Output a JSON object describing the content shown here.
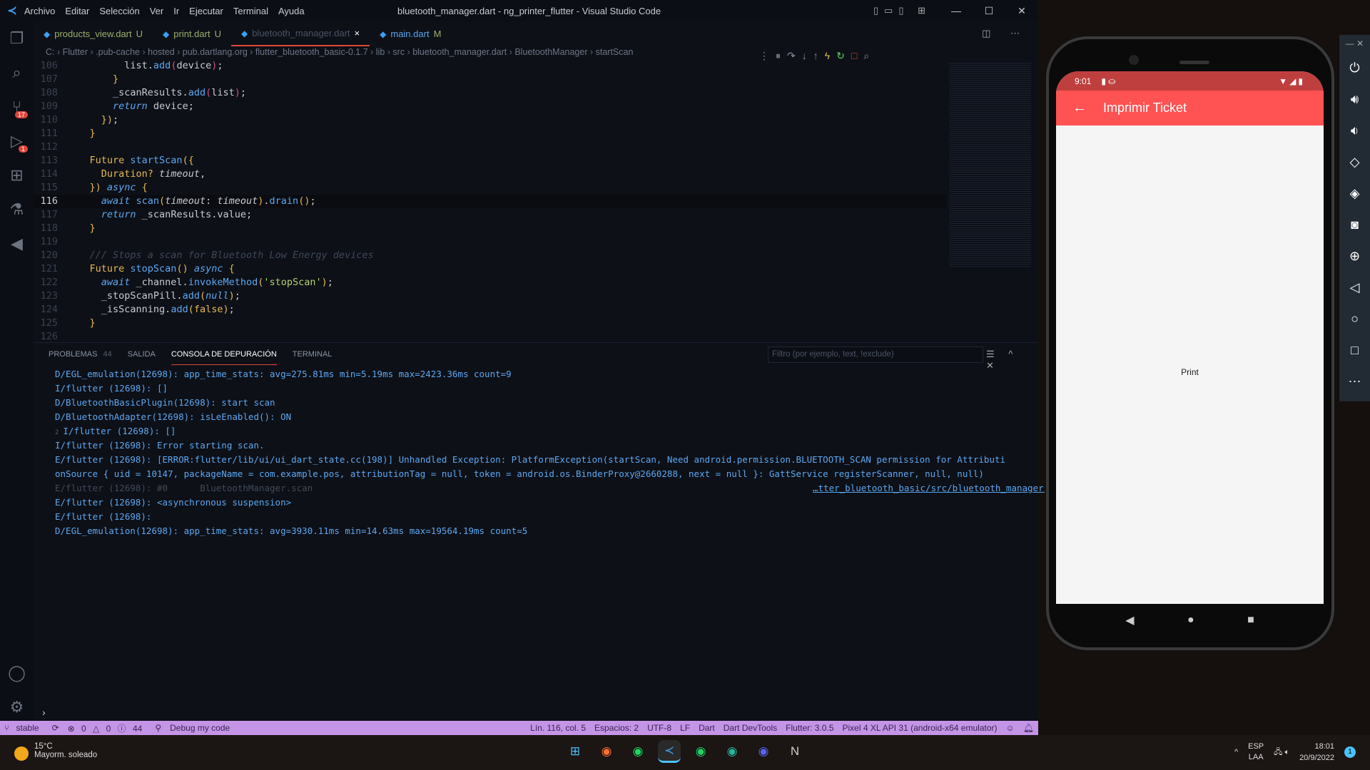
{
  "window": {
    "title": "bluetooth_manager.dart - ng_printer_flutter - Visual Studio Code",
    "menu": [
      "Archivo",
      "Editar",
      "Selección",
      "Ver",
      "Ir",
      "Ejecutar",
      "Terminal",
      "Ayuda"
    ]
  },
  "tabs": [
    {
      "label": "products_view.dart",
      "status": "U"
    },
    {
      "label": "print.dart",
      "status": "U"
    },
    {
      "label": "bluetooth_manager.dart",
      "status": "×",
      "active": true
    },
    {
      "label": "main.dart",
      "status": "M"
    }
  ],
  "breadcrumb": [
    "C:",
    "Flutter",
    ".pub-cache",
    "hosted",
    "pub.dartlang.org",
    "flutter_bluetooth_basic-0.1.7",
    "lib",
    "src",
    "bluetooth_manager.dart",
    "BluetoothManager",
    "startScan"
  ],
  "activity_badges": {
    "source_control": "17",
    "run": "1"
  },
  "code": [
    {
      "n": "106",
      "t": [
        [
          "pl",
          "          list."
        ],
        [
          "fn",
          "add"
        ],
        [
          "par",
          "("
        ],
        [
          "pl",
          "device"
        ],
        [
          "par",
          ")"
        ],
        [
          "pl",
          ";"
        ]
      ]
    },
    {
      "n": "107",
      "t": [
        [
          "br",
          "        }"
        ]
      ]
    },
    {
      "n": "108",
      "t": [
        [
          "pl",
          "        _scanResults."
        ],
        [
          "fn",
          "add"
        ],
        [
          "par",
          "("
        ],
        [
          "pl",
          "list"
        ],
        [
          "par",
          ")"
        ],
        [
          "pl",
          ";"
        ]
      ]
    },
    {
      "n": "109",
      "t": [
        [
          "it",
          "        return"
        ],
        [
          "pl",
          " device;"
        ]
      ]
    },
    {
      "n": "110",
      "t": [
        [
          "br",
          "      })"
        ],
        [
          "pl",
          ";"
        ]
      ]
    },
    {
      "n": "111",
      "t": [
        [
          "br",
          "    }"
        ]
      ]
    },
    {
      "n": "112",
      "t": []
    },
    {
      "n": "113",
      "t": [
        [
          "kw",
          "    Future"
        ],
        [
          "fn",
          " startScan"
        ],
        [
          "br",
          "({"
        ]
      ]
    },
    {
      "n": "114",
      "t": [
        [
          "kw",
          "      Duration?"
        ],
        [
          "prm",
          " timeout"
        ],
        [
          "pl",
          ","
        ]
      ]
    },
    {
      "n": "115",
      "t": [
        [
          "br",
          "    })"
        ],
        [
          "it",
          " async"
        ],
        [
          "br",
          " {"
        ]
      ]
    },
    {
      "n": "116",
      "cur": true,
      "t": [
        [
          "it",
          "      await"
        ],
        [
          "fn",
          " scan"
        ],
        [
          "br",
          "("
        ],
        [
          "prm",
          "timeout"
        ],
        [
          "pl",
          ": "
        ],
        [
          "prm",
          "timeout"
        ],
        [
          "br",
          ")"
        ],
        [
          "pl",
          "."
        ],
        [
          "fn",
          "drain"
        ],
        [
          "br",
          "()"
        ],
        [
          "pl",
          ";"
        ]
      ]
    },
    {
      "n": "117",
      "t": [
        [
          "it",
          "      return"
        ],
        [
          "pl",
          " _scanResults.value;"
        ]
      ]
    },
    {
      "n": "118",
      "t": [
        [
          "br",
          "    }"
        ]
      ]
    },
    {
      "n": "119",
      "t": []
    },
    {
      "n": "120",
      "t": [
        [
          "cm",
          "    /// Stops a scan for Bluetooth Low Energy devices"
        ]
      ]
    },
    {
      "n": "121",
      "t": [
        [
          "kw",
          "    Future"
        ],
        [
          "fn",
          " stopScan"
        ],
        [
          "br",
          "()"
        ],
        [
          "it",
          " async"
        ],
        [
          "br",
          " {"
        ]
      ]
    },
    {
      "n": "122",
      "t": [
        [
          "it",
          "      await"
        ],
        [
          "pl",
          " _channel."
        ],
        [
          "fn",
          "invokeMethod"
        ],
        [
          "br",
          "("
        ],
        [
          "str",
          "'stopScan'"
        ],
        [
          "br",
          ")"
        ],
        [
          "pl",
          ";"
        ]
      ]
    },
    {
      "n": "123",
      "t": [
        [
          "pl",
          "      _stopScanPill."
        ],
        [
          "fn",
          "add"
        ],
        [
          "br",
          "("
        ],
        [
          "it",
          "null"
        ],
        [
          "br",
          ")"
        ],
        [
          "pl",
          ";"
        ]
      ]
    },
    {
      "n": "124",
      "t": [
        [
          "pl",
          "      _isScanning."
        ],
        [
          "fn",
          "add"
        ],
        [
          "br",
          "("
        ],
        [
          "kw",
          "false"
        ],
        [
          "br",
          ")"
        ],
        [
          "pl",
          ";"
        ]
      ]
    },
    {
      "n": "125",
      "t": [
        [
          "br",
          "    }"
        ]
      ]
    },
    {
      "n": "126",
      "t": []
    }
  ],
  "panel": {
    "tabs": [
      "PROBLEMAS",
      "SALIDA",
      "CONSOLA DE DEPURACIÓN",
      "TERMINAL"
    ],
    "problems_count": "44",
    "active": "CONSOLA DE DEPURACIÓN",
    "filter_placeholder": "Filtro (por ejemplo, text, !exclude)"
  },
  "console": [
    {
      "text": "D/EGL_emulation(12698): app_time_stats: avg=275.81ms min=5.19ms max=2423.36ms count=9"
    },
    {
      "text": "I/flutter (12698): []"
    },
    {
      "text": "D/BluetoothBasicPlugin(12698): start scan"
    },
    {
      "text": "D/BluetoothAdapter(12698): isLeEnabled(): ON"
    },
    {
      "text": "I/flutter (12698): []",
      "repeat": "2"
    },
    {
      "text": "I/flutter (12698): Error starting scan."
    },
    {
      "text": "E/flutter (12698): [ERROR:flutter/lib/ui/ui_dart_state.cc(198)] Unhandled Exception: PlatformException(startScan, Need android.permission.BLUETOOTH_SCAN permission for Attributi"
    },
    {
      "text": "onSource { uid = 10147, packageName = com.example.pos, attributionTag = null, token = android.os.BinderProxy@2660288, next = null }: GattService registerScanner, null, null)"
    },
    {
      "text": "E/flutter (12698): #0      BluetoothManager.scan",
      "dim": true,
      "link": "…tter_bluetooth_basic/src/bluetooth_manager.dart:85"
    },
    {
      "text": "E/flutter (12698): <asynchronous suspension>"
    },
    {
      "text": "E/flutter (12698):"
    },
    {
      "text": "D/EGL_emulation(12698): app_time_stats: avg=3930.11ms min=14.63ms max=19564.19ms count=5"
    }
  ],
  "statusbar": {
    "branch": "stable",
    "errors": "0",
    "warnings": "0",
    "info": "44",
    "debug": "Debug my code",
    "position": "Lín. 116, col. 5",
    "spaces": "Espacios: 2",
    "encoding": "UTF-8",
    "eol": "LF",
    "language": "Dart",
    "devtools": "Dart DevTools",
    "flutter": "Flutter: 3.0.5",
    "device": "Pixel 4 XL API 31 (android-x64 emulator)",
    "color": "#c494e6"
  },
  "taskbar": {
    "temp": "15°C",
    "weather": "Mayorm. soleado",
    "lang": "ESP",
    "layout": "LAA",
    "time": "18:01",
    "date": "20/9/2022",
    "notifications": "1"
  },
  "phone": {
    "time": "9:01",
    "appbar_title": "Imprimir Ticket",
    "button": "Print",
    "appbar_color": "#ff5252"
  }
}
